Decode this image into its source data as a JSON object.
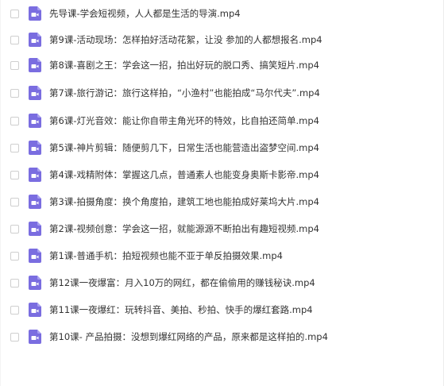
{
  "colors": {
    "icon_purple": "#7a6de0",
    "text": "#333333",
    "checkbox_border": "#cfcfcf"
  },
  "files": [
    {
      "name": "先导课-学会短视频，人人都是生活的导演.mp4",
      "icon": "video-file-icon"
    },
    {
      "name": "第9课-活动现场：怎样拍好活动花絮，让没 参加的人都想报名.mp4",
      "icon": "video-file-icon"
    },
    {
      "name": "第8课-喜剧之王：学会这一招，拍出好玩的脱口秀、搞笑短片.mp4",
      "icon": "video-file-icon"
    },
    {
      "name": "第7课-旅行游记：旅行这样拍，“小渔村”也能拍成“马尔代夫”.mp4",
      "icon": "video-file-icon"
    },
    {
      "name": "第6课-灯光音效：能让你自带主角光环的特效，比自拍还简单.mp4",
      "icon": "video-file-icon"
    },
    {
      "name": "第5课-神片剪辑：随便剪几下，日常生活也能营造出盗梦空间.mp4",
      "icon": "video-file-icon"
    },
    {
      "name": "第4课-戏精附体：掌握这几点，普通素人也能变身奥斯卡影帝.mp4",
      "icon": "video-file-icon"
    },
    {
      "name": "第3课-拍摄角度：换个角度拍，建筑工地也能拍成好莱坞大片.mp4",
      "icon": "video-file-icon"
    },
    {
      "name": "第2课-视频创意：学会这一招，就能源源不断拍出有趣短视频.mp4",
      "icon": "video-file-icon"
    },
    {
      "name": "第1课-普通手机：拍短视频也能不亚于单反拍摄效果.mp4",
      "icon": "video-file-icon"
    },
    {
      "name": "第12课一夜爆富：月入10万的网红，都在偷偷用的赚钱秘诀.mp4",
      "icon": "video-file-icon"
    },
    {
      "name": "第11课一夜爆红：玩转抖音、美拍、秒拍、快手的爆红套路.mp4",
      "icon": "video-file-icon"
    },
    {
      "name": "第10课- 产品拍摄：没想到爆红网络的产品，原来都是这样拍的.mp4",
      "icon": "video-file-icon"
    }
  ]
}
